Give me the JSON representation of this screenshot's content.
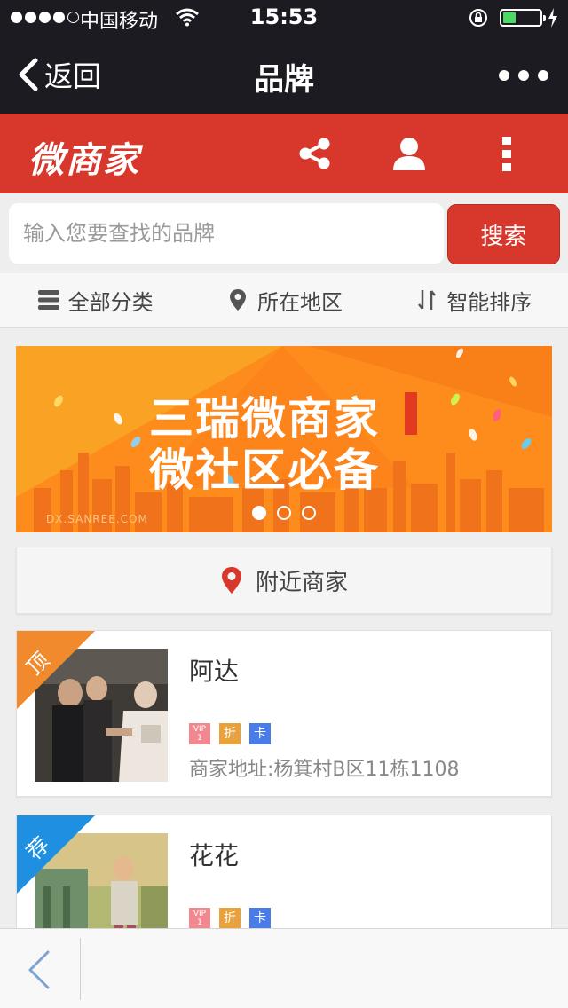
{
  "status_bar": {
    "carrier": "中国移动",
    "time": "15:53",
    "battery_level": 0.35,
    "battery_color": "#4cd964"
  },
  "nav": {
    "back_label": "返回",
    "title": "品牌",
    "more_icon": "more-dots-icon"
  },
  "header": {
    "logo_text": "微商家",
    "background": "#d7382b",
    "icons": [
      "share-icon",
      "user-icon",
      "kebab-menu-icon"
    ]
  },
  "search": {
    "placeholder": "输入您要查找的品牌",
    "value": "",
    "button_label": "搜索"
  },
  "filters": [
    {
      "label": "全部分类",
      "icon": "list-icon"
    },
    {
      "label": "所在地区",
      "icon": "location-pin-icon"
    },
    {
      "label": "智能排序",
      "icon": "sort-icon"
    }
  ],
  "banner": {
    "line1": "三瑞微商家",
    "line2": "微社区必备",
    "url": "DX.SANREE.COM",
    "slides": 3,
    "active_slide": 1
  },
  "nearby": {
    "label": "附近商家",
    "icon": "location-pin-icon"
  },
  "merchants": [
    {
      "ribbon": "顶",
      "ribbon_color": "#f08a2c",
      "name": "阿达",
      "badges": [
        "VIP 1",
        "折",
        "卡"
      ],
      "address": "商家地址:杨箕村B区11栋1108"
    },
    {
      "ribbon": "荐",
      "ribbon_color": "#1e8fe1",
      "name": "花花",
      "badges": [
        "VIP 1",
        "折",
        "卡"
      ],
      "address": ""
    }
  ],
  "bottom_bar": {
    "back_icon": "chevron-left-icon"
  }
}
